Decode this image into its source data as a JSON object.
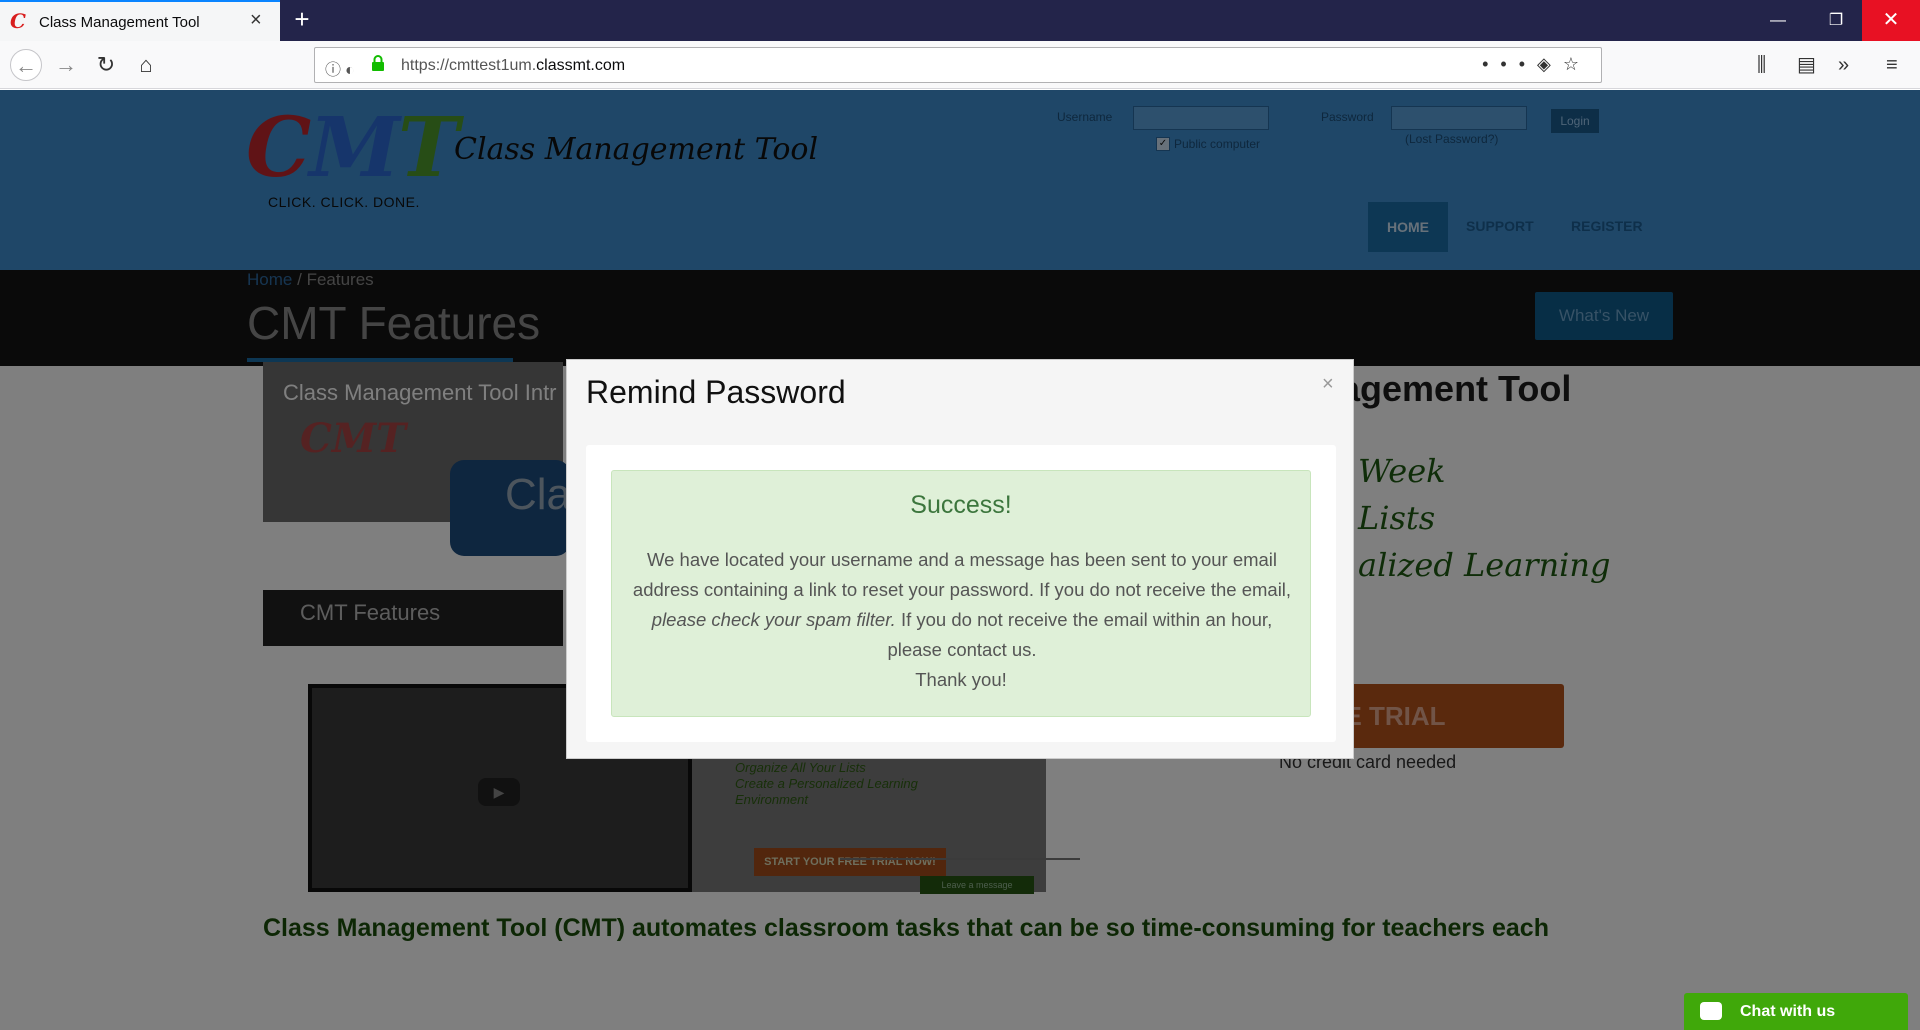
{
  "browser": {
    "tab_title": "Class Management Tool",
    "url_prefix": "https://cmttest1um.",
    "url_domain": "classmt.com",
    "favicon_letter": "C",
    "tab_close": "×",
    "new_tab": "+",
    "icons": {
      "back": "←",
      "forward": "→",
      "reload": "↻",
      "home": "⌂",
      "more": "•••",
      "pocket": "◈",
      "bookmark": "☆",
      "library": "⫼",
      "sidebar": "▤",
      "overflow": "»",
      "menu": "≡",
      "win_min": "—",
      "win_restore": "❐",
      "win_close": "✕",
      "info": "ⓘ",
      "tracking": "◐"
    }
  },
  "site": {
    "logo_c": "C",
    "logo_m": "M",
    "logo_t": "T",
    "logo_title": "Class Management Tool",
    "tagline": "CLICK. CLICK. DONE.",
    "login": {
      "username_label": "Username",
      "password_label": "Password",
      "login_button": "Login",
      "public_computer": "Public computer",
      "lost_password": "(Lost Password?)",
      "checkmark": "✓"
    },
    "nav": {
      "home": "HOME",
      "support": "SUPPORT",
      "register": "REGISTER"
    },
    "breadcrumb": {
      "home": "Home",
      "sep": "/",
      "current": "Features"
    },
    "page_title": "CMT Features",
    "whats_new": "What's New",
    "video1": {
      "title": "Class Management Tool Intr",
      "logo": "CMT",
      "features": "CMT Features",
      "cla": "Cla"
    },
    "video2": {
      "play": "▶"
    },
    "side_list": [
      "Organize All Your Lists",
      "Create a Personalized Learning",
      "Environment"
    ],
    "side_trial": "START YOUR FREE TRIAL NOW!",
    "side_leave": "Leave a message",
    "right_title": "agement Tool",
    "script_lines": [
      "Week",
      "Lists",
      "alized Learning"
    ],
    "free_trial": "FREE TRIAL",
    "no_card": "No credit card needed",
    "bottom_text": "Class Management Tool (CMT) automates classroom tasks that can be so time-consuming for teachers each"
  },
  "modal": {
    "title": "Remind Password",
    "close": "×",
    "alert_heading": "Success!",
    "msg_part1": "We have located your username and a message has been sent to your email address containing a link to reset your password. If you do not receive the email,",
    "msg_em": "please check your spam filter.",
    "msg_part2": "If you do not receive the email within an hour, please contact us.",
    "thanks": "Thank you!"
  },
  "chat": {
    "label": "Chat with us"
  }
}
